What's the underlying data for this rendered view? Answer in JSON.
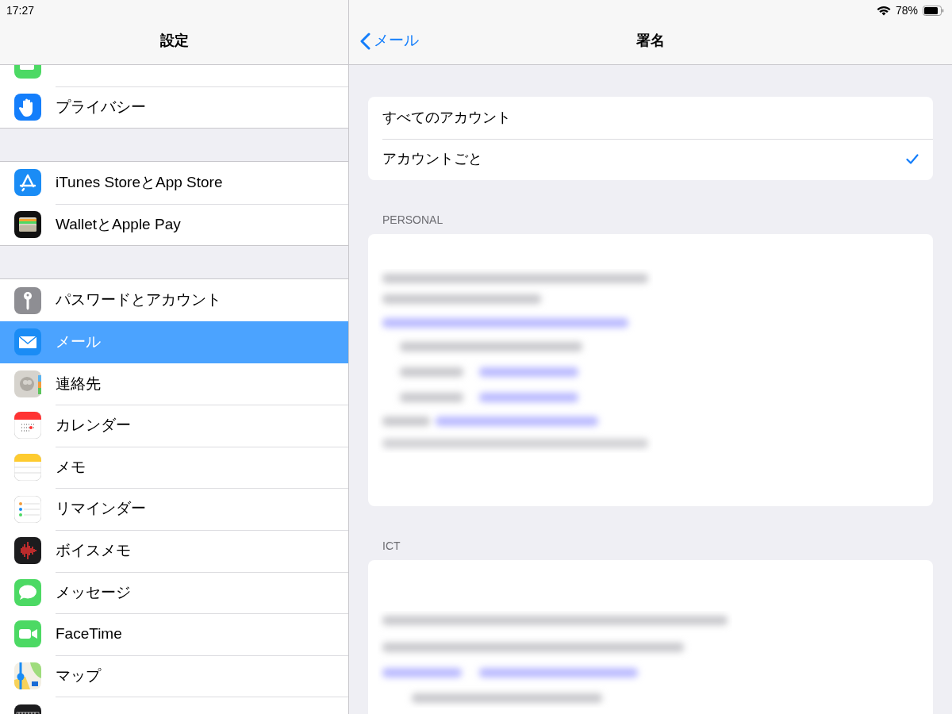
{
  "status_bar": {
    "time": "17:27",
    "battery_percent": "78%"
  },
  "sidebar": {
    "title": "設定",
    "sections": [
      {
        "items": [
          {
            "kind": "battery",
            "selected": false
          },
          {
            "kind": "privacy",
            "label": "プライバシー",
            "selected": false
          }
        ]
      },
      {
        "items": [
          {
            "kind": "appstore",
            "label": "iTunes StoreとApp Store",
            "selected": false
          },
          {
            "kind": "wallet",
            "label": "WalletとApple Pay",
            "selected": false
          }
        ]
      },
      {
        "items": [
          {
            "kind": "passwords",
            "label": "パスワードとアカウント",
            "selected": false
          },
          {
            "kind": "mail",
            "label": "メール",
            "selected": true
          },
          {
            "kind": "contacts",
            "label": "連絡先",
            "selected": false
          },
          {
            "kind": "calendar",
            "label": "カレンダー",
            "selected": false
          },
          {
            "kind": "notes",
            "label": "メモ",
            "selected": false
          },
          {
            "kind": "reminders",
            "label": "リマインダー",
            "selected": false
          },
          {
            "kind": "voicememos",
            "label": "ボイスメモ",
            "selected": false
          },
          {
            "kind": "messages",
            "label": "メッセージ",
            "selected": false
          },
          {
            "kind": "facetime",
            "label": "FaceTime",
            "selected": false
          },
          {
            "kind": "maps",
            "label": "マップ",
            "selected": false
          },
          {
            "kind": "measure",
            "selected": false
          }
        ]
      }
    ]
  },
  "detail": {
    "back_label": "メール",
    "title": "署名",
    "options": [
      {
        "label": "すべてのアカウント",
        "selected": false
      },
      {
        "label": "アカウントごと",
        "selected": true
      }
    ],
    "groups": [
      {
        "header": "PERSONAL"
      },
      {
        "header": "ICT"
      }
    ]
  }
}
